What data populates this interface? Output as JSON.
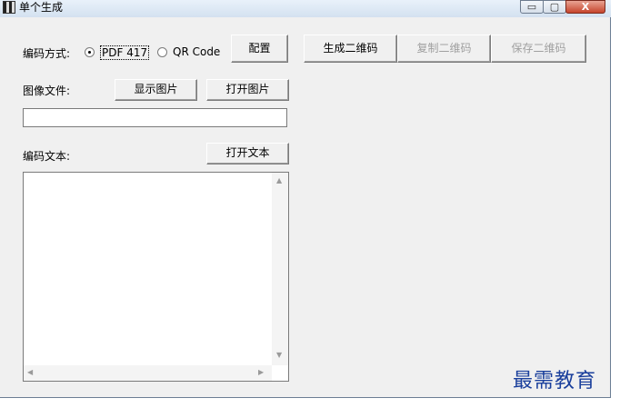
{
  "window": {
    "title": "单个生成",
    "controls": {
      "minimize": "▭",
      "maximize": "▢",
      "close": "X"
    }
  },
  "encoding": {
    "label": "编码方式:",
    "options": [
      {
        "label": "PDF 417",
        "selected": true
      },
      {
        "label": "QR Code",
        "selected": false
      }
    ],
    "config_button": "配置"
  },
  "actions": {
    "generate": "生成二维码",
    "copy": "复制二维码",
    "save": "保存二维码"
  },
  "image_file": {
    "label": "图像文件:",
    "show_button": "显示图片",
    "open_button": "打开图片",
    "path_value": ""
  },
  "text": {
    "label": "编码文本:",
    "open_button": "打开文本",
    "content": ""
  },
  "scroll_glyphs": {
    "up": "▲",
    "down": "▼",
    "left": "◀",
    "right": "▶"
  },
  "watermark": "最需教育"
}
